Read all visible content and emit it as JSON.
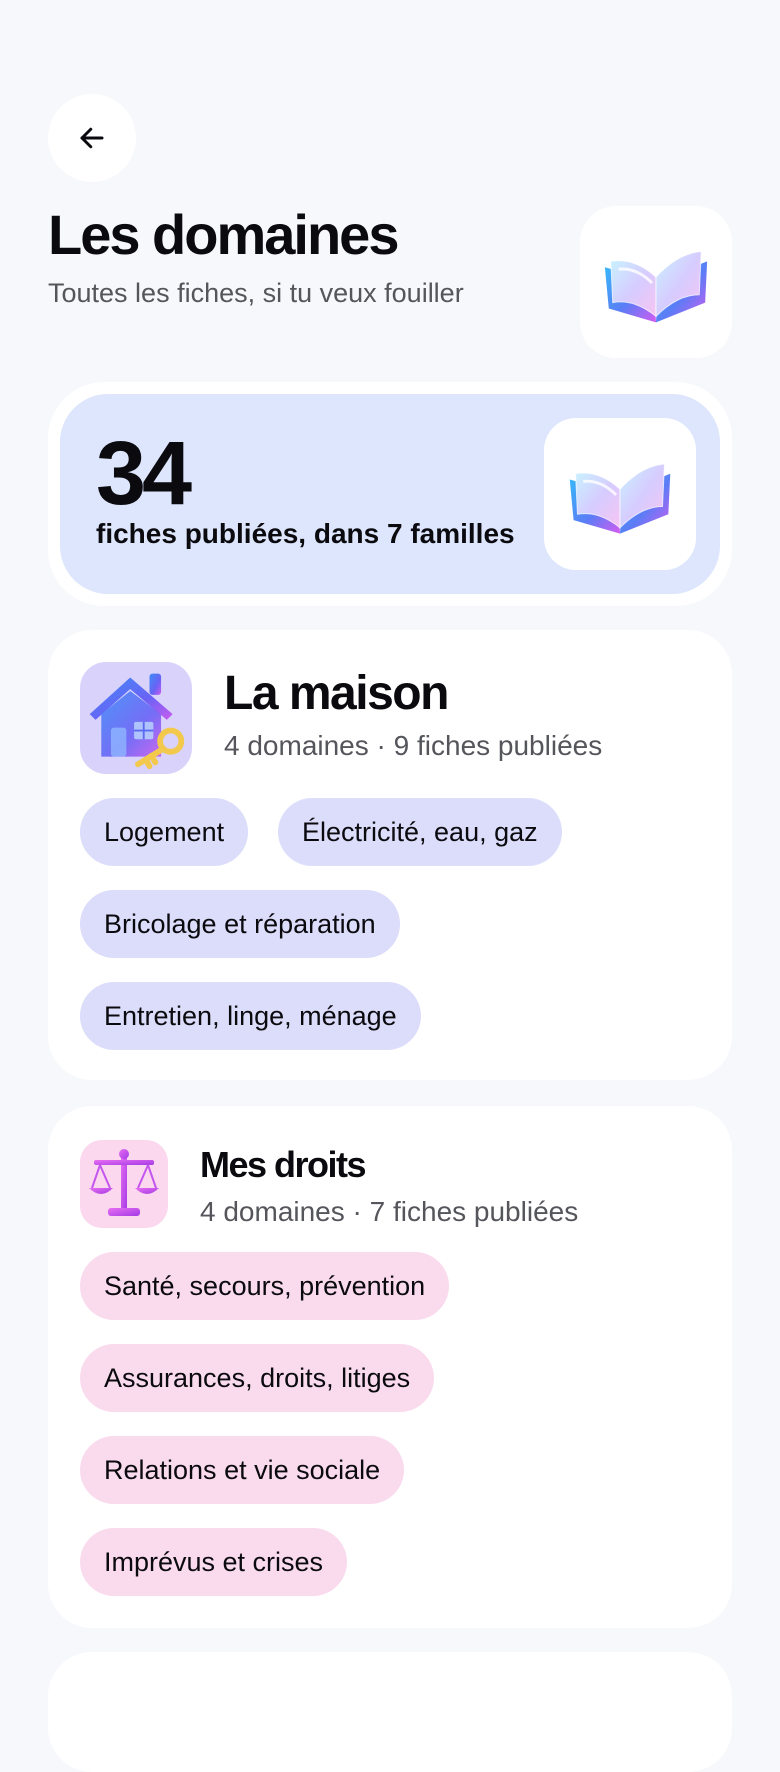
{
  "header": {
    "back_icon": "arrow-left-icon",
    "title": "Les domaines",
    "subtitle": "Toutes les fiches, si tu veux fouiller",
    "illustration": "open-book-icon"
  },
  "stats": {
    "count": "34",
    "caption": "fiches publiées, dans 7 familles",
    "illustration": "open-book-icon",
    "background": "#dde6fc"
  },
  "families": [
    {
      "title": "La maison",
      "meta": "4 domaines · 9 fiches publiées",
      "icon": "house-key-icon",
      "chip_color": "#dcdcfb",
      "domains": [
        "Logement",
        "Électricité, eau, gaz",
        "Bricolage et réparation",
        "Entretien, linge, ménage"
      ]
    },
    {
      "title": "Mes droits",
      "meta": "4 domaines · 7 fiches publiées",
      "icon": "scales-of-justice-icon",
      "chip_color": "#fadbee",
      "domains": [
        "Santé, secours, prévention",
        "Assurances, droits, litiges",
        "Relations et vie sociale",
        "Imprévus et crises"
      ]
    }
  ]
}
